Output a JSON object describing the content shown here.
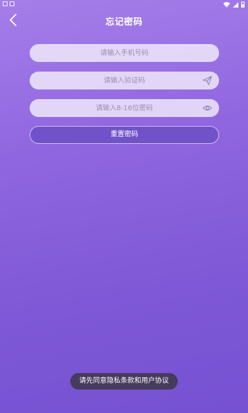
{
  "header": {
    "title": "忘记密码",
    "back_icon": "chevron-left-icon"
  },
  "form": {
    "phone_placeholder": "请输入手机号码",
    "code_placeholder": "请输入验证码",
    "code_icon": "send-icon",
    "password_placeholder": "请输入8-16位密码",
    "password_icon": "eye-icon",
    "submit_label": "重置密码"
  },
  "toast": {
    "message": "请先同意隐私条款和用户协议"
  },
  "colors": {
    "gradient_top": "#a57ee9",
    "gradient_bottom": "#7552d2",
    "button_bg": "#7152c9",
    "toast_bg": "#3c3746"
  }
}
